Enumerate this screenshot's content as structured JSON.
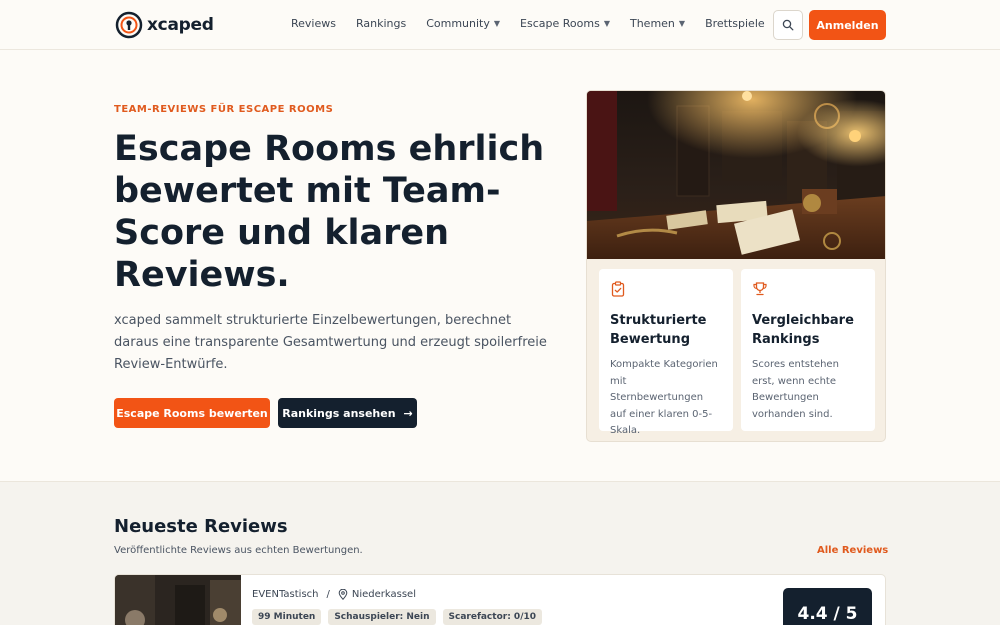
{
  "brand": {
    "name": "xcaped"
  },
  "nav": {
    "items": [
      {
        "label": "Reviews",
        "dropdown": false
      },
      {
        "label": "Rankings",
        "dropdown": false
      },
      {
        "label": "Community",
        "dropdown": true
      },
      {
        "label": "Escape Rooms",
        "dropdown": true
      },
      {
        "label": "Themen",
        "dropdown": true
      },
      {
        "label": "Brettspiele",
        "dropdown": false
      }
    ],
    "search_icon": "search-icon",
    "login_label": "Anmelden"
  },
  "hero": {
    "eyebrow": "TEAM-REVIEWS FÜR ESCAPE ROOMS",
    "title": "Escape Rooms ehrlich bewertet mit Team-Score und klaren Reviews.",
    "text": "xcaped sammelt strukturierte Einzelbewertungen, berechnet daraus eine transparente Gesamtwertung und erzeugt spoilerfreie Review-Entwürfe.",
    "primary_button": "Escape Rooms bewerten",
    "secondary_button": "Rankings ansehen"
  },
  "features": [
    {
      "icon": "clipboard-check-icon",
      "title": "Strukturierte Bewertung",
      "text": "Kompakte Kategorien mit Sternbewertungen auf einer klaren 0-5-Skala."
    },
    {
      "icon": "trophy-icon",
      "title": "Vergleichbare Rankings",
      "text": "Scores entstehen erst, wenn echte Bewertungen vorhanden sind."
    }
  ],
  "latest": {
    "title": "Neueste Reviews",
    "subtitle": "Veröffentlichte Reviews aus echten Bewertungen.",
    "all_link": "Alle Reviews",
    "review": {
      "operator": "EVENTastisch",
      "separator": "/",
      "location": "Niederkassel",
      "tags": [
        "99 Minuten",
        "Schauspieler: Nein",
        "Scarefactor: 0/10"
      ],
      "score": "4.4 / 5"
    }
  },
  "colors": {
    "accent": "#f25415",
    "dark": "#14202e",
    "background": "#fdfbf7"
  }
}
